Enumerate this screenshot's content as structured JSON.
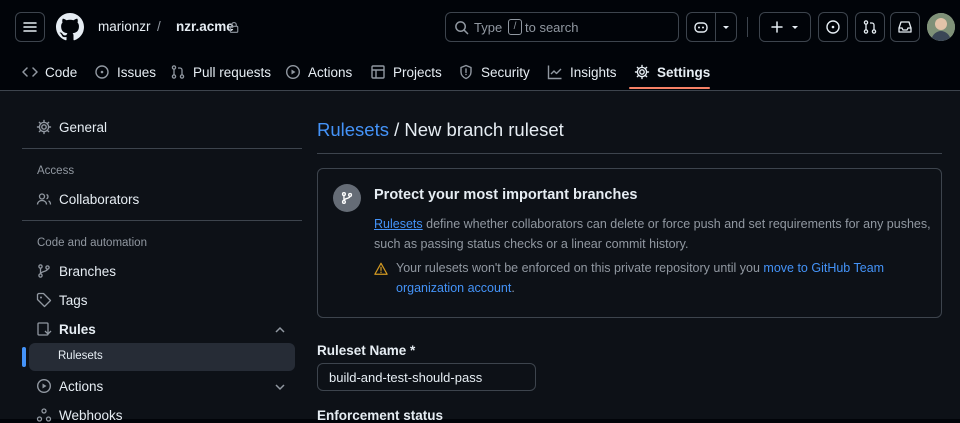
{
  "header": {
    "owner": "marionzr",
    "separator": "/",
    "repo": "nzr.acme",
    "search_prefix": "Type",
    "search_key": "/",
    "search_suffix": "to search"
  },
  "tabs": [
    {
      "label": "Code"
    },
    {
      "label": "Issues"
    },
    {
      "label": "Pull requests"
    },
    {
      "label": "Actions"
    },
    {
      "label": "Projects"
    },
    {
      "label": "Security"
    },
    {
      "label": "Insights"
    },
    {
      "label": "Settings"
    }
  ],
  "sidebar": {
    "general": "General",
    "access_heading": "Access",
    "collaborators": "Collaborators",
    "code_heading": "Code and automation",
    "branches": "Branches",
    "tags": "Tags",
    "rules": "Rules",
    "rulesets": "Rulesets",
    "actions": "Actions",
    "webhooks": "Webhooks"
  },
  "page": {
    "breadcrumb_link": "Rulesets",
    "breadcrumb_rest": " / New branch ruleset"
  },
  "info_card": {
    "title": "Protect your most important branches",
    "link": "Rulesets",
    "desc_line1": " define whether collaborators can delete or force push and set requirements for any pushes,",
    "desc_line2": "such as passing status checks or a linear commit history.",
    "warning_text": "Your rulesets won't be enforced on this private repository until you ",
    "warning_link_line1": "move to GitHub Team",
    "warning_link_line2": "organization account",
    "warning_end": "."
  },
  "form": {
    "name_label": "Ruleset Name *",
    "name_value": "build-and-test-should-pass",
    "enforcement_label": "Enforcement status"
  },
  "colors": {
    "background": "#0d1117",
    "header": "#010409",
    "border": "#3d444d",
    "accent_link": "#4493f8",
    "active_tab": "#f78166",
    "warning": "#d29922"
  }
}
